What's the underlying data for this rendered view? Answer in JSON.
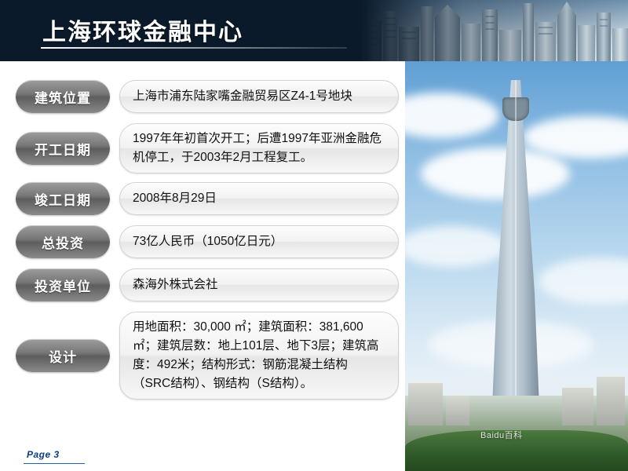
{
  "header": {
    "title": "上海环球金融中心"
  },
  "rows": [
    {
      "label": "建筑位置",
      "value": "上海市浦东陆家嘴金融贸易区Z4-1号地块"
    },
    {
      "label": "开工日期",
      "value": "1997年年初首次开工；后遭1997年亚洲金融危机停工，于2003年2月工程复工。"
    },
    {
      "label": "竣工日期",
      "value": "2008年8月29日"
    },
    {
      "label": "总投资",
      "value": "73亿人民币（1050亿日元）"
    },
    {
      "label": "投资单位",
      "value": "森海外株式会社"
    },
    {
      "label": "设计",
      "value": "用地面积：30,000 ㎡；建筑面积：381,600 ㎡；建筑层数：地上101层、地下3层；建筑高度：492米；结构形式：钢筋混凝土结构（SRC结构）、钢结构（S结构）。"
    }
  ],
  "photo": {
    "alt_name": "shanghai-world-financial-center-photo",
    "watermark": "Baidu百科"
  },
  "footer": {
    "page_label": "Page  3"
  },
  "colors": {
    "header_bg": "#0a1a2a",
    "label_gray": "#767676",
    "value_bg": "#f2f2f2",
    "footer_blue": "#0a3f86"
  }
}
